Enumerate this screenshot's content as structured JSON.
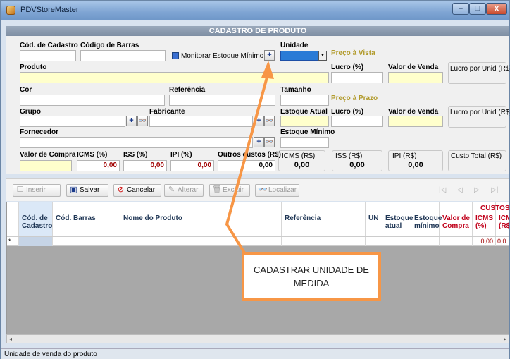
{
  "window": {
    "title": "PDVStoreMaster",
    "min": "–",
    "max": "□",
    "close": "x"
  },
  "header": {
    "title": "CADASTRO DE PRODUTO"
  },
  "form": {
    "cod_cadastro": "Cód. de Cadastro",
    "codigo_barras": "Código de Barras",
    "monitorar": "Monitorar Estoque Mínimo",
    "unidade": "Unidade",
    "produto": "Produto",
    "cor": "Cor",
    "referencia": "Referência",
    "tamanho": "Tamanho",
    "grupo": "Grupo",
    "fabricante": "Fabricante",
    "estoque_atual": "Estoque Atual",
    "fornecedor": "Fornecedor",
    "estoque_minimo": "Estoque Mínimo",
    "valor_compra": "Valor de Compra",
    "icms_pct": "ICMS (%)",
    "iss_pct": "ISS (%)",
    "ipi_pct": "IPI (%)",
    "outros_custos": "Outros custos (R$)",
    "icms_val": "0,00",
    "iss_val": "0,00",
    "ipi_val": "0,00",
    "outros_val": "0,00",
    "plus": "+",
    "bino": "👓"
  },
  "totals": {
    "icms_rs": "ICMS (R$)",
    "icms_rs_val": "0,00",
    "iss_rs": "ISS (R$)",
    "iss_rs_val": "0,00",
    "ipi_rs": "IPI (R$)",
    "ipi_rs_val": "0,00",
    "custo_total": "Custo Total (R$)"
  },
  "vista": {
    "title": "Preço à Vista",
    "lucro": "Lucro (%)",
    "valor_venda": "Valor de Venda",
    "lucro_unid": "Lucro por Unid (R$)"
  },
  "prazo": {
    "title": "Preço à Prazo",
    "lucro": "Lucro (%)",
    "valor_venda": "Valor de Venda",
    "lucro_unid": "Lucro por Unid (R$)"
  },
  "toolbar": {
    "inserir": "Inserir",
    "salvar": "Salvar",
    "cancelar": "Cancelar",
    "alterar": "Alterar",
    "excluir": "Excluir",
    "localizar": "Localizar",
    "nav_first": "|◁",
    "nav_prev": "◁",
    "nav_next": "▷",
    "nav_last": "▷|"
  },
  "grid": {
    "columns": [
      "Cód. de Cadastro",
      "Cód. Barras",
      "Nome do Produto",
      "Referência",
      "UN",
      "Estoque atual",
      "Estoque mínimo",
      "Valor de Compra",
      "ICMS (%)",
      "ICMS (R$)"
    ],
    "group_custos": "CUSTOS",
    "row_marker": "*",
    "row_icms_pct": "0,00",
    "row_icms_rs": "0,0"
  },
  "status": {
    "text": "Unidade de venda do produto"
  },
  "annotation": {
    "text": "CADASTRAR UNIDADE DE MEDIDA"
  },
  "colors": {
    "callout_border": "#f79646",
    "section_title": "#b19a2a",
    "value_red": "#a00000"
  }
}
